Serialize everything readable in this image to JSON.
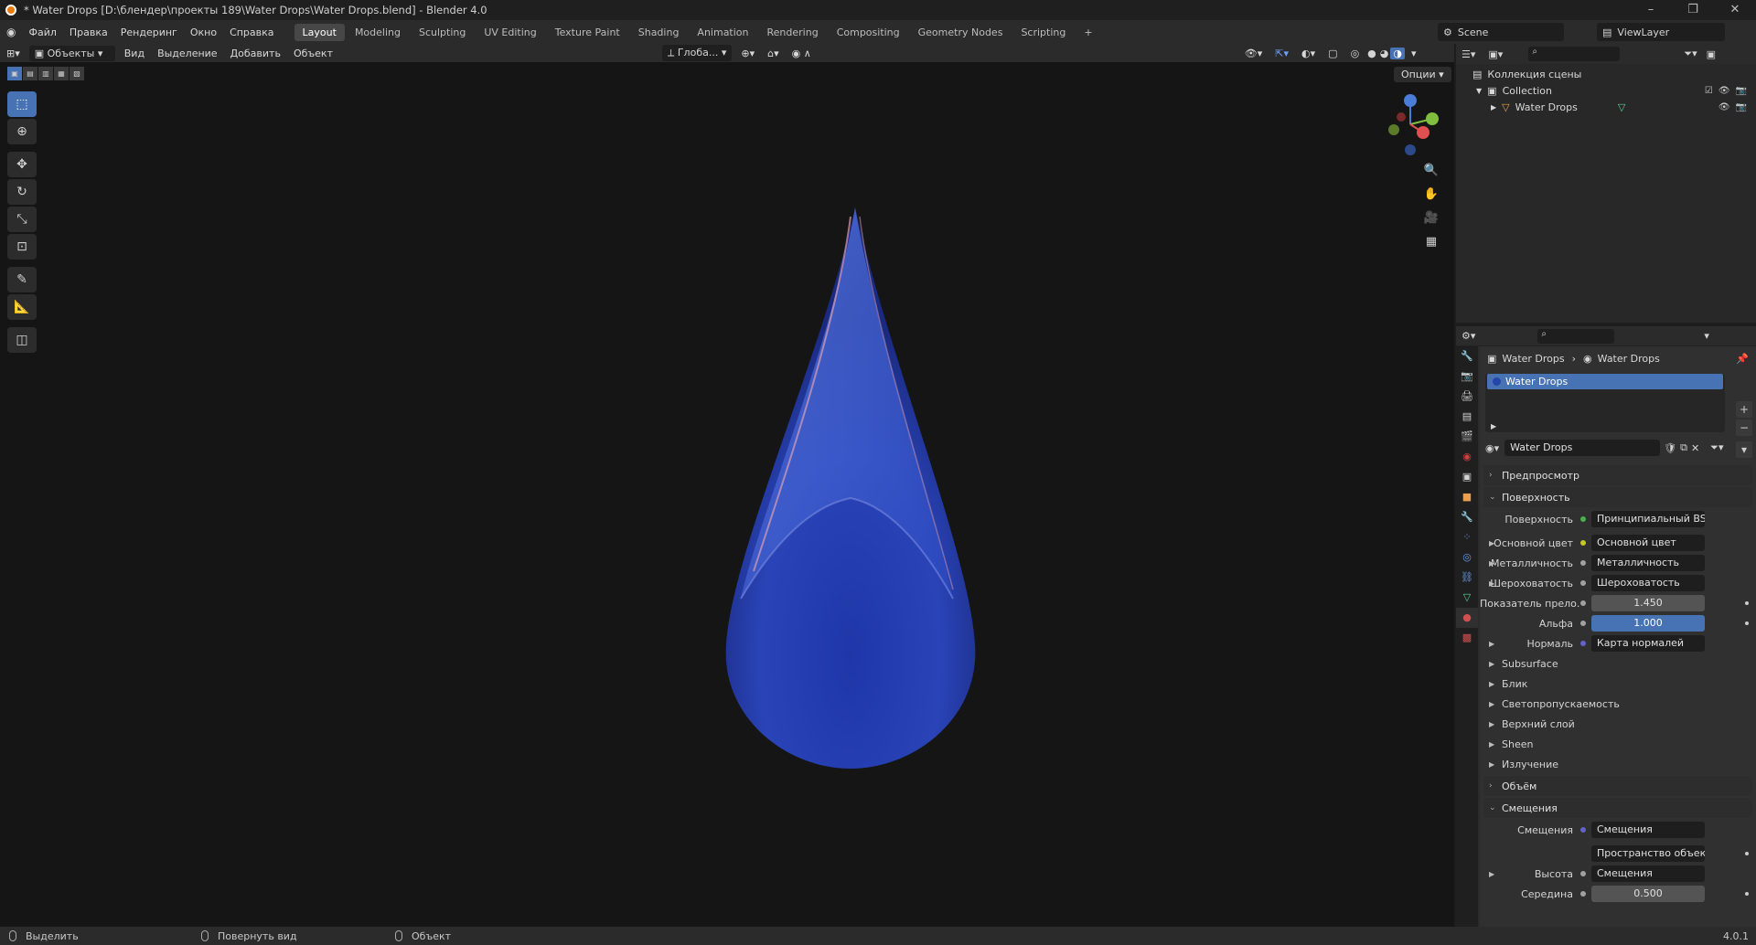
{
  "window": {
    "title": "* Water Drops [D:\\блендер\\проекты 189\\Water Drops\\Water Drops.blend] - Blender 4.0",
    "buttons": [
      "–",
      "❐",
      "✕"
    ]
  },
  "menu": [
    "Файл",
    "Правка",
    "Рендеринг",
    "Окно",
    "Справка"
  ],
  "workspaces": [
    "Layout",
    "Modeling",
    "Sculpting",
    "UV Editing",
    "Texture Paint",
    "Shading",
    "Animation",
    "Rendering",
    "Compositing",
    "Geometry Nodes",
    "Scripting"
  ],
  "active_workspace": "Layout",
  "add_workspace": "+",
  "scene": "Scene",
  "view_layer": "ViewLayer",
  "viewport_header": {
    "mode": "Объекты",
    "menus": [
      "Вид",
      "Выделение",
      "Добавить",
      "Объект"
    ],
    "orientation": "Глоба...",
    "options": "Опции"
  },
  "outliner": {
    "root": "Коллекция сцены",
    "collection": "Collection",
    "object": "Water Drops"
  },
  "properties": {
    "breadcrumb": [
      "Water Drops",
      "Water Drops"
    ],
    "slot": "Water Drops",
    "material": "Water Drops",
    "panels": {
      "preview": "Предпросмотр",
      "surface": "Поверхность",
      "volume": "Объём",
      "displacement": "Смещения"
    },
    "surface_rows": [
      {
        "label": "Поверхность",
        "value": "Принципиальный BSDF",
        "socket": "#4caf50"
      },
      {
        "label": "Основной цвет",
        "value": "Основной цвет",
        "socket": "#c7c729"
      },
      {
        "label": "Металличность",
        "value": "Металличность",
        "socket": "#a1a1a1"
      },
      {
        "label": "Шероховатость",
        "value": "Шероховатость",
        "socket": "#a1a1a1"
      },
      {
        "label": "Показатель прело...",
        "value": "1.450",
        "socket": "#a1a1a1"
      },
      {
        "label": "Альфа",
        "value": "1.000",
        "socket": "#a1a1a1"
      },
      {
        "label": "Нормаль",
        "value": "Карта нормалей",
        "socket": "#6363c7"
      }
    ],
    "subsections": [
      "Subsurface",
      "Блик",
      "Светопропускаемость",
      "Верхний слой",
      "Sheen",
      "Излучение"
    ],
    "displacement_rows": {
      "label": "Смещения",
      "value": "Смещения",
      "space": "Пространство объекта",
      "height_label": "Высота",
      "height_value": "Смещения",
      "mid_label": "Середина",
      "mid_value": "0.500"
    }
  },
  "statusbar": {
    "select": "Выделить",
    "rotate": "Повернуть вид",
    "object": "Объект",
    "version": "4.0.1"
  }
}
